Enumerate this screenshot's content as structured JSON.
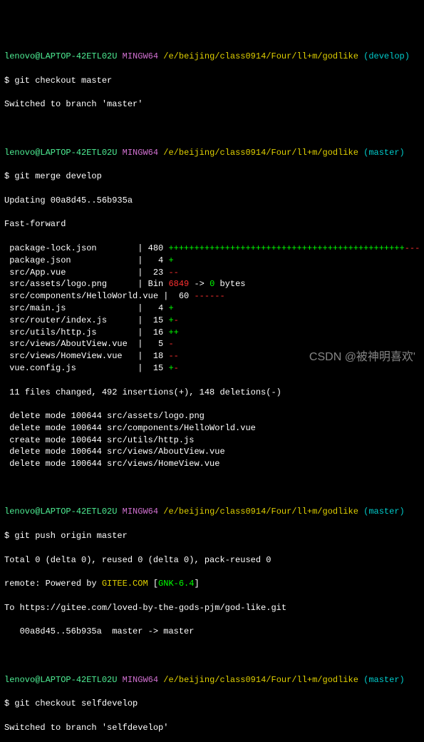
{
  "prompt1": {
    "user": "lenovo@LAPTOP-42ETL02U",
    "host": "MINGW64",
    "path": "/e/beijing/class0914/Four/ll+m/godlike",
    "branch": "(develop)"
  },
  "cmd1": "$ git checkout master",
  "out1": "Switched to branch 'master'",
  "prompt2": {
    "user": "lenovo@LAPTOP-42ETL02U",
    "host": "MINGW64",
    "path": "/e/beijing/class0914/Four/ll+m/godlike",
    "branch": "(master)"
  },
  "cmd2": "$ git merge develop",
  "merge_update": "Updating 00a8d45..56b935a",
  "merge_ff": "Fast-forward",
  "files": [
    {
      "name": " package-lock.json        ",
      "sep": "|",
      "count": " 480 ",
      "plus": "++++++++++++++++++++++++++++++++++++++++++++++",
      "minus": "---"
    },
    {
      "name": " package.json             ",
      "sep": "|",
      "count": "   4 ",
      "plus": "+",
      "minus": ""
    },
    {
      "name": " src/App.vue              ",
      "sep": "|",
      "count": "  23 ",
      "plus": "",
      "minus": "--"
    },
    {
      "name": " src/assets/logo.png      ",
      "sep": "|",
      "count": " Bin ",
      "binfrom": "6849",
      "binarrow": " -> ",
      "binto": "0",
      "binend": " bytes"
    },
    {
      "name": " src/components/HelloWorld.vue ",
      "sep": "|",
      "count": "  60 ",
      "plus": "",
      "minus": "------"
    },
    {
      "name": " src/main.js              ",
      "sep": "|",
      "count": "   4 ",
      "plus": "+",
      "minus": ""
    },
    {
      "name": " src/router/index.js      ",
      "sep": "|",
      "count": "  15 ",
      "plus": "+",
      "minus": "-"
    },
    {
      "name": " src/utils/http.js        ",
      "sep": "|",
      "count": "  16 ",
      "plus": "++",
      "minus": ""
    },
    {
      "name": " src/views/AboutView.vue  ",
      "sep": "|",
      "count": "   5 ",
      "plus": "",
      "minus": "-"
    },
    {
      "name": " src/views/HomeView.vue   ",
      "sep": "|",
      "count": "  18 ",
      "plus": "",
      "minus": "--"
    },
    {
      "name": " vue.config.js            ",
      "sep": "|",
      "count": "  15 ",
      "plus": "+",
      "minus": "-"
    }
  ],
  "summary": " 11 files changed, 492 insertions(+), 148 deletions(-)",
  "deletes": [
    " delete mode 100644 src/assets/logo.png",
    " delete mode 100644 src/components/HelloWorld.vue",
    " create mode 100644 src/utils/http.js",
    " delete mode 100644 src/views/AboutView.vue",
    " delete mode 100644 src/views/HomeView.vue"
  ],
  "prompt3": {
    "user": "lenovo@LAPTOP-42ETL02U",
    "host": "MINGW64",
    "path": "/e/beijing/class0914/Four/ll+m/godlike",
    "branch": "(master)"
  },
  "cmd3": "$ git push origin master",
  "push": {
    "l1": "Total 0 (delta 0), reused 0 (delta 0), pack-reused 0",
    "l2a": "remote: Powered by ",
    "l2b": "GITEE.COM ",
    "l2c": "[",
    "l2d": "GNK-6.4",
    "l2e": "]",
    "l3": "To https://gitee.com/loved-by-the-gods-pjm/god-like.git",
    "l4": "   00a8d45..56b935a  master -> master"
  },
  "prompt4": {
    "user": "lenovo@LAPTOP-42ETL02U",
    "host": "MINGW64",
    "path": "/e/beijing/class0914/Four/ll+m/godlike",
    "branch": "(master)"
  },
  "cmd4": "$ git checkout selfdevelop",
  "out4": "Switched to branch 'selfdevelop'",
  "watermark": "CSDN @被神明喜欢'"
}
